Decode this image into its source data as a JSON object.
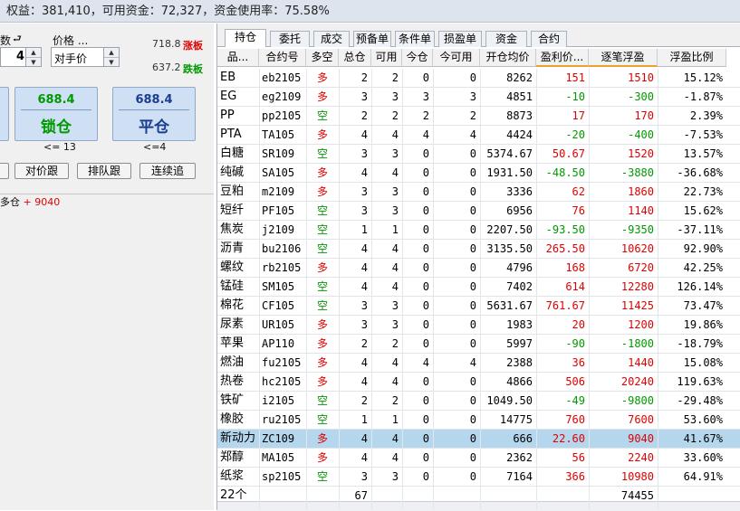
{
  "topbar": {
    "text": "权益：381,410，可用资金：72,327，资金使用率：75.58%"
  },
  "left": {
    "qty_label": "数",
    "qty_value": "4",
    "price_label": "价格 ...",
    "price_value": "对手价",
    "limit_up_price": "718.8",
    "limit_up_label": "涨板",
    "limit_down_price": "637.2",
    "limit_down_label": "跌板",
    "lock_price": "688.4",
    "lock_label": "锁仓",
    "close_price": "688.4",
    "close_label": "平仓",
    "lock_cond": "<= 13",
    "close_cond": "<=4",
    "btn_counter_follow": "对价跟",
    "btn_queue_follow": "排队跟",
    "btn_continuous": "连续追",
    "position_label": "多仓",
    "position_value": "+ 9040"
  },
  "tabs": [
    "持仓",
    "委托",
    "成交",
    "预备单",
    "条件单",
    "损盈单",
    "资金",
    "合约"
  ],
  "columns": [
    "品...",
    "合约号",
    "多空",
    "总仓",
    "可用",
    "今仓",
    "今可用",
    "开仓均价",
    "盈利价...",
    "逐笔浮盈",
    "浮盈比例"
  ],
  "rows": [
    {
      "name": "EB",
      "contract": "eb2105",
      "dir": "多",
      "total": "2",
      "avail": "2",
      "today": "0",
      "today_avail": "0",
      "avg": "8262",
      "pp": "151",
      "pnl": "1510",
      "ratio": "15.12%"
    },
    {
      "name": "EG",
      "contract": "eg2109",
      "dir": "多",
      "total": "3",
      "avail": "3",
      "today": "3",
      "today_avail": "3",
      "avg": "4851",
      "pp": "-10",
      "pnl": "-300",
      "ratio": "-1.87%"
    },
    {
      "name": "PP",
      "contract": "pp2105",
      "dir": "空",
      "total": "2",
      "avail": "2",
      "today": "2",
      "today_avail": "2",
      "avg": "8873",
      "pp": "17",
      "pnl": "170",
      "ratio": "2.39%"
    },
    {
      "name": "PTA",
      "contract": "TA105",
      "dir": "多",
      "total": "4",
      "avail": "4",
      "today": "4",
      "today_avail": "4",
      "avg": "4424",
      "pp": "-20",
      "pnl": "-400",
      "ratio": "-7.53%"
    },
    {
      "name": "白糖",
      "contract": "SR109",
      "dir": "空",
      "total": "3",
      "avail": "3",
      "today": "0",
      "today_avail": "0",
      "avg": "5374.67",
      "pp": "50.67",
      "pnl": "1520",
      "ratio": "13.57%"
    },
    {
      "name": "纯碱",
      "contract": "SA105",
      "dir": "多",
      "total": "4",
      "avail": "4",
      "today": "0",
      "today_avail": "0",
      "avg": "1931.50",
      "pp": "-48.50",
      "pnl": "-3880",
      "ratio": "-36.68%"
    },
    {
      "name": "豆粕",
      "contract": "m2109",
      "dir": "多",
      "total": "3",
      "avail": "3",
      "today": "0",
      "today_avail": "0",
      "avg": "3336",
      "pp": "62",
      "pnl": "1860",
      "ratio": "22.73%"
    },
    {
      "name": "短纤",
      "contract": "PF105",
      "dir": "空",
      "total": "3",
      "avail": "3",
      "today": "0",
      "today_avail": "0",
      "avg": "6956",
      "pp": "76",
      "pnl": "1140",
      "ratio": "15.62%"
    },
    {
      "name": "焦炭",
      "contract": "j2109",
      "dir": "空",
      "total": "1",
      "avail": "1",
      "today": "0",
      "today_avail": "0",
      "avg": "2207.50",
      "pp": "-93.50",
      "pnl": "-9350",
      "ratio": "-37.11%"
    },
    {
      "name": "沥青",
      "contract": "bu2106",
      "dir": "空",
      "total": "4",
      "avail": "4",
      "today": "0",
      "today_avail": "0",
      "avg": "3135.50",
      "pp": "265.50",
      "pnl": "10620",
      "ratio": "92.90%"
    },
    {
      "name": "螺纹",
      "contract": "rb2105",
      "dir": "多",
      "total": "4",
      "avail": "4",
      "today": "0",
      "today_avail": "0",
      "avg": "4796",
      "pp": "168",
      "pnl": "6720",
      "ratio": "42.25%"
    },
    {
      "name": "锰硅",
      "contract": "SM105",
      "dir": "空",
      "total": "4",
      "avail": "4",
      "today": "0",
      "today_avail": "0",
      "avg": "7402",
      "pp": "614",
      "pnl": "12280",
      "ratio": "126.14%"
    },
    {
      "name": "棉花",
      "contract": "CF105",
      "dir": "空",
      "total": "3",
      "avail": "3",
      "today": "0",
      "today_avail": "0",
      "avg": "5631.67",
      "pp": "761.67",
      "pnl": "11425",
      "ratio": "73.47%"
    },
    {
      "name": "尿素",
      "contract": "UR105",
      "dir": "多",
      "total": "3",
      "avail": "3",
      "today": "0",
      "today_avail": "0",
      "avg": "1983",
      "pp": "20",
      "pnl": "1200",
      "ratio": "19.86%"
    },
    {
      "name": "苹果",
      "contract": "AP110",
      "dir": "多",
      "total": "2",
      "avail": "2",
      "today": "0",
      "today_avail": "0",
      "avg": "5997",
      "pp": "-90",
      "pnl": "-1800",
      "ratio": "-18.79%"
    },
    {
      "name": "燃油",
      "contract": "fu2105",
      "dir": "多",
      "total": "4",
      "avail": "4",
      "today": "4",
      "today_avail": "4",
      "avg": "2388",
      "pp": "36",
      "pnl": "1440",
      "ratio": "15.08%"
    },
    {
      "name": "热卷",
      "contract": "hc2105",
      "dir": "多",
      "total": "4",
      "avail": "4",
      "today": "0",
      "today_avail": "0",
      "avg": "4866",
      "pp": "506",
      "pnl": "20240",
      "ratio": "119.63%"
    },
    {
      "name": "铁矿",
      "contract": "i2105",
      "dir": "空",
      "total": "2",
      "avail": "2",
      "today": "0",
      "today_avail": "0",
      "avg": "1049.50",
      "pp": "-49",
      "pnl": "-9800",
      "ratio": "-29.48%"
    },
    {
      "name": "橡胶",
      "contract": "ru2105",
      "dir": "空",
      "total": "1",
      "avail": "1",
      "today": "0",
      "today_avail": "0",
      "avg": "14775",
      "pp": "760",
      "pnl": "7600",
      "ratio": "53.60%"
    },
    {
      "name": "新动力",
      "contract": "ZC109",
      "dir": "多",
      "total": "4",
      "avail": "4",
      "today": "0",
      "today_avail": "0",
      "avg": "666",
      "pp": "22.60",
      "pnl": "9040",
      "ratio": "41.67%"
    },
    {
      "name": "郑醇",
      "contract": "MA105",
      "dir": "多",
      "total": "4",
      "avail": "4",
      "today": "0",
      "today_avail": "0",
      "avg": "2362",
      "pp": "56",
      "pnl": "2240",
      "ratio": "33.60%"
    },
    {
      "name": "纸浆",
      "contract": "sp2105",
      "dir": "空",
      "total": "3",
      "avail": "3",
      "today": "0",
      "today_avail": "0",
      "avg": "7164",
      "pp": "366",
      "pnl": "10980",
      "ratio": "64.91%"
    }
  ],
  "summary": {
    "name": "22个",
    "total": "67",
    "pnl": "74455"
  },
  "selected_row": 19,
  "colors": {
    "long": "#e00000",
    "short": "#009900",
    "profit": "#e00000",
    "loss": "#009900",
    "selection": "#b5d7ee",
    "header_bg": "#dde4ee"
  }
}
